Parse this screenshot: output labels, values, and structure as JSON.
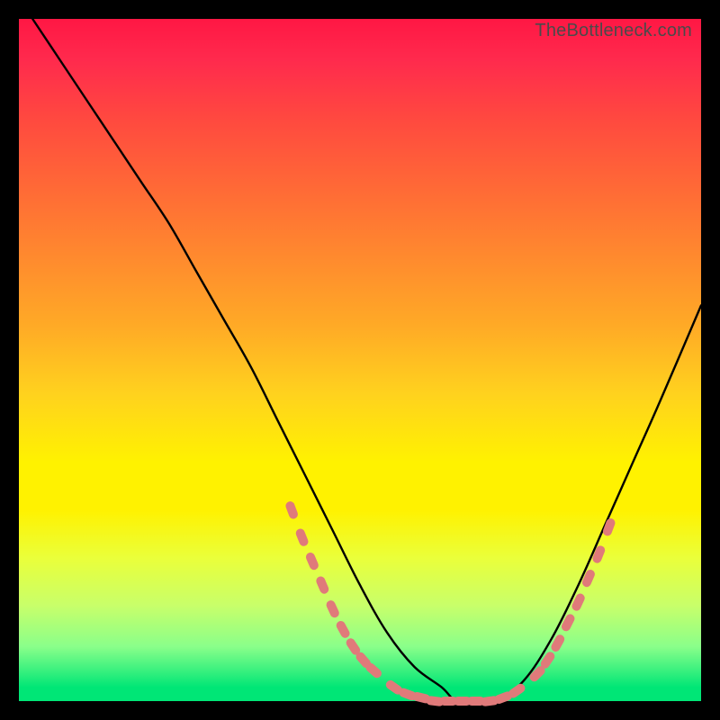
{
  "watermark": "TheBottleneck.com",
  "colors": {
    "gradient_top": "#ff1744",
    "gradient_mid": "#fff200",
    "gradient_bottom": "#00e676",
    "curve": "#000000",
    "dots": "#e07a7a",
    "frame": "#000000"
  },
  "chart_data": {
    "type": "line",
    "title": "",
    "xlabel": "",
    "ylabel": "",
    "xlim": [
      0,
      100
    ],
    "ylim": [
      0,
      100
    ],
    "grid": false,
    "legend": false,
    "series": [
      {
        "name": "bottleneck-curve",
        "x": [
          2,
          6,
          10,
          14,
          18,
          22,
          26,
          30,
          34,
          38,
          42,
          46,
          50,
          54,
          58,
          62,
          64,
          66,
          70,
          74,
          78,
          82,
          86,
          90,
          94,
          100
        ],
        "y": [
          100,
          94,
          88,
          82,
          76,
          70,
          63,
          56,
          49,
          41,
          33,
          25,
          17,
          10,
          5,
          2,
          0,
          0,
          0,
          3,
          9,
          17,
          26,
          35,
          44,
          58
        ]
      }
    ],
    "markers": {
      "name": "highlight-dots",
      "x": [
        40,
        41.5,
        43,
        44.5,
        46,
        47.5,
        49,
        50.5,
        52,
        55,
        57,
        59,
        61,
        63,
        65,
        67,
        69,
        71,
        73,
        76,
        77.5,
        79,
        80.5,
        82,
        83.5,
        85,
        86.5
      ],
      "y": [
        28,
        24,
        20.5,
        17,
        13.5,
        10.5,
        8,
        6,
        4.5,
        2,
        1,
        0.5,
        0,
        0,
        0,
        0,
        0,
        0.5,
        1.5,
        4,
        6,
        8.5,
        11.5,
        14.5,
        18,
        21.5,
        25.5
      ]
    }
  }
}
